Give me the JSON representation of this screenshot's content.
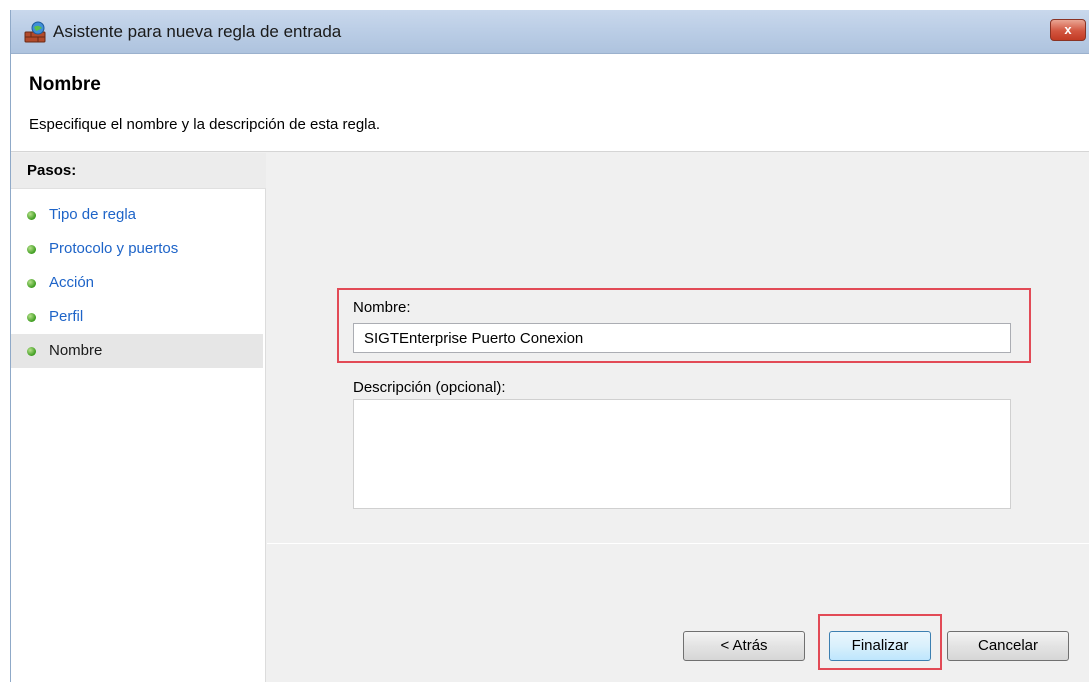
{
  "window": {
    "title": "Asistente para nueva regla de entrada",
    "close_label": "x"
  },
  "header": {
    "title": "Nombre",
    "subtitle": "Especifique el nombre y la descripción de esta regla."
  },
  "steps": {
    "heading": "Pasos:",
    "items": [
      {
        "label": "Tipo de regla"
      },
      {
        "label": "Protocolo y puertos"
      },
      {
        "label": "Acción"
      },
      {
        "label": "Perfil"
      },
      {
        "label": "Nombre",
        "current": true
      }
    ]
  },
  "form": {
    "name_label": "Nombre:",
    "name_value": "SIGTEnterprise Puerto Conexion",
    "description_label": "Descripción (opcional):",
    "description_value": ""
  },
  "buttons": {
    "back": "< Atrás",
    "finish": "Finalizar",
    "cancel": "Cancelar"
  },
  "colors": {
    "highlight": "#e24a56",
    "link": "#1e64c8",
    "step_dot": "#3d9c1f"
  },
  "icons": {
    "window": "firewall-wizard-icon",
    "step": "green-dot-icon"
  }
}
